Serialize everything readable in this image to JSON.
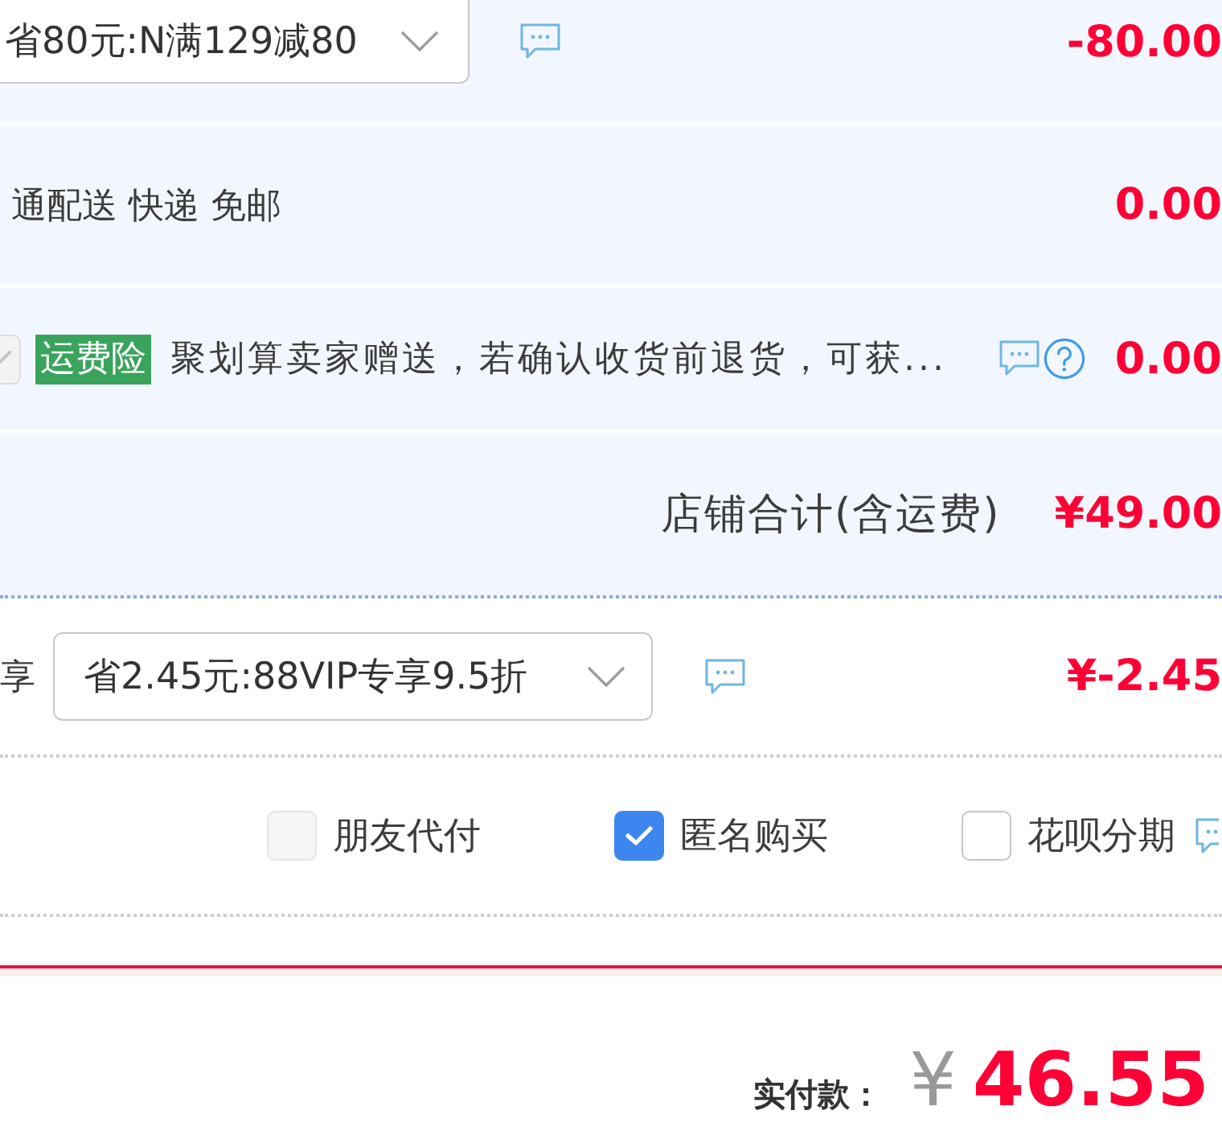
{
  "discount_row": {
    "select": {
      "value": "省80元:N满129减80"
    },
    "amount": "-80.00"
  },
  "shipping_row": {
    "text": "通配送 快递 免邮",
    "amount": "0.00"
  },
  "insurance_row": {
    "checked": true,
    "tag": "运费险",
    "text": "聚划算卖家赠送，若确认收货前退货，可获...",
    "amount": "0.00"
  },
  "shop_total": {
    "label": "店铺合计(含运费)",
    "amount": "¥49.00"
  },
  "vip_row": {
    "label": "享",
    "select": {
      "value": "省2.45元:88VIP专享9.5折"
    },
    "amount": "¥-2.45"
  },
  "options": [
    {
      "label": "朋友代付",
      "checked": false,
      "disabled": true
    },
    {
      "label": "匿名购买",
      "checked": true,
      "disabled": false
    },
    {
      "label": "花呗分期",
      "checked": false,
      "disabled": false
    }
  ],
  "payment": {
    "label": "实付款：",
    "currency": "¥",
    "amount": "46.55"
  }
}
